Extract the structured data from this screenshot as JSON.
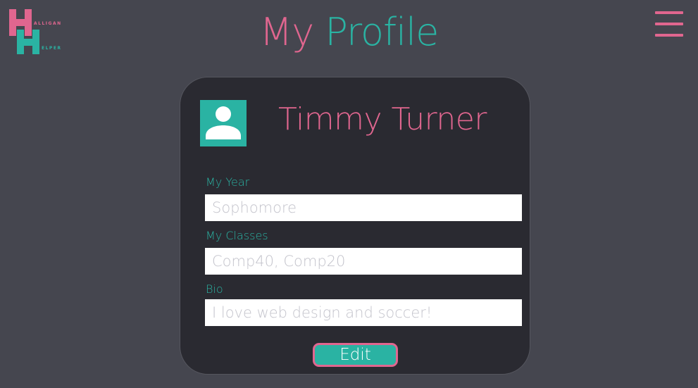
{
  "colors": {
    "background": "#45464f",
    "card": "#2a2a31",
    "pink": "#e0668f",
    "teal": "#2ab3a3",
    "input": "#ffffff"
  },
  "logo": {
    "line1": "ALLIGAN",
    "line2": "ELPER",
    "icon": "halligan-helper-logo"
  },
  "header": {
    "title_part1": "My",
    "title_part2": "Profile",
    "menu_icon": "hamburger-menu-icon"
  },
  "profile": {
    "avatar_icon": "user-avatar-icon",
    "name": "Timmy Turner",
    "fields": [
      {
        "label": "My Year",
        "placeholder": "Sophomore"
      },
      {
        "label": "My Classes",
        "placeholder": "Comp40, Comp20"
      },
      {
        "label": "Bio",
        "placeholder": "I love web design and soccer!"
      }
    ],
    "edit_label": "Edit"
  }
}
